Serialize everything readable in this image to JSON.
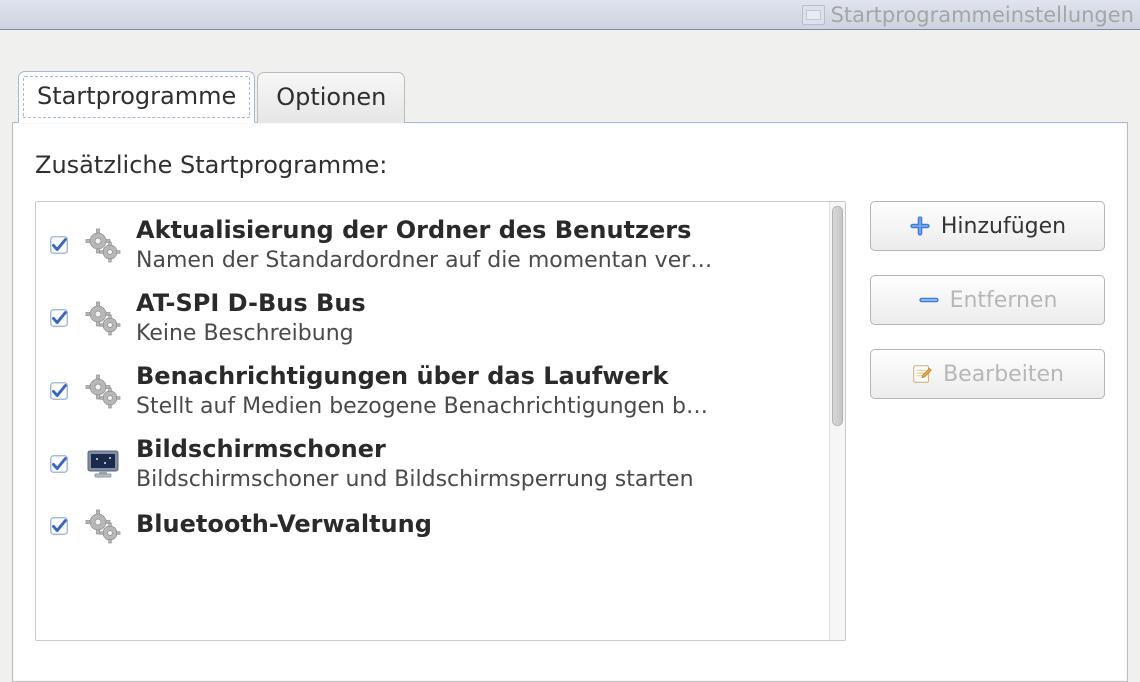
{
  "titlebar": {
    "title": "Startprogrammeinstellungen"
  },
  "tabs": [
    {
      "label": "Startprogramme"
    },
    {
      "label": "Optionen"
    }
  ],
  "section_label": "Zusätzliche Startprogramme:",
  "buttons": {
    "add": "Hinzufügen",
    "remove": "Entfernen",
    "edit": "Bearbeiten"
  },
  "items": [
    {
      "title": "Aktualisierung der Ordner des Benutzers",
      "desc": "Namen der Standardordner auf die momentan ver…",
      "icon": "gears"
    },
    {
      "title": "AT-SPI D-Bus Bus",
      "desc": "Keine Beschreibung",
      "icon": "gears"
    },
    {
      "title": "Benachrichtigungen über das Laufwerk",
      "desc": "Stellt auf Medien bezogene Benachrichtigungen b…",
      "icon": "gears"
    },
    {
      "title": "Bildschirmschoner",
      "desc": "Bildschirmschoner und Bildschirmsperrung starten",
      "icon": "monitor"
    },
    {
      "title": "Bluetooth-Verwaltung",
      "desc": "",
      "icon": "gears"
    }
  ]
}
